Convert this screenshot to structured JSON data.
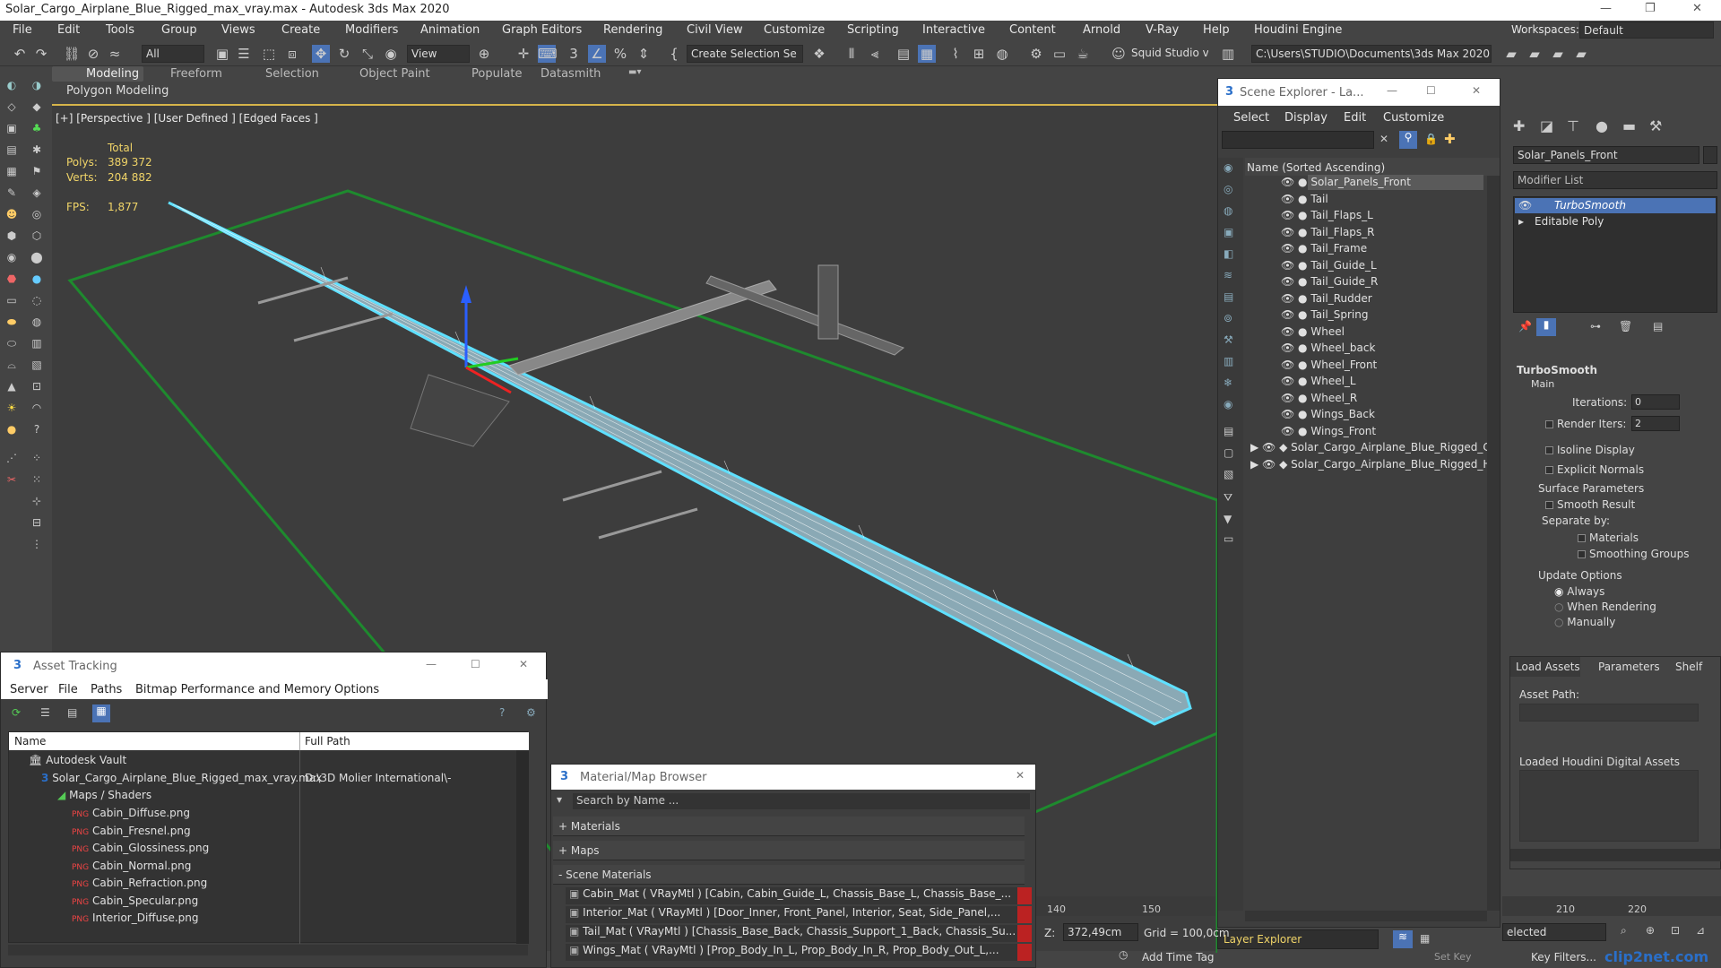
{
  "window": {
    "title": "Solar_Cargo_Airplane_Blue_Rigged_max_vray.max - Autodesk 3ds Max 2020"
  },
  "menu": [
    "File",
    "Edit",
    "Tools",
    "Group",
    "Views",
    "Create",
    "Modifiers",
    "Animation",
    "Graph Editors",
    "Rendering",
    "Civil View",
    "Customize",
    "Scripting",
    "Interactive",
    "Content",
    "Arnold",
    "V-Ray",
    "Help",
    "Houdini Engine"
  ],
  "workspaces": {
    "label": "Workspaces:",
    "value": "Default"
  },
  "toolbar": {
    "filter": "All",
    "ref_coord": "View",
    "selection_set": "Create Selection Se",
    "account": "Squid Studio v",
    "path": "C:\\Users\\STUDIO\\Documents\\3ds Max 2020"
  },
  "ribbon": {
    "tabs": [
      "Modeling",
      "Freeform",
      "Selection",
      "Object Paint",
      "Populate",
      "Datasmith"
    ],
    "sub": "Polygon Modeling"
  },
  "viewport": {
    "label": "[+] [Perspective ] [User Defined ] [Edged Faces ]",
    "total": "Total",
    "polys_label": "Polys:",
    "polys": "389 372",
    "verts_label": "Verts:",
    "verts": "204 882",
    "fps_label": "FPS:",
    "fps": "1,877"
  },
  "scene_explorer": {
    "title": "Scene Explorer - La...",
    "menus": [
      "Select",
      "Display",
      "Edit",
      "Customize"
    ],
    "column": "Name (Sorted Ascending)",
    "items": [
      "Solar_Panels_Front",
      "Tail",
      "Tail_Flaps_L",
      "Tail_Flaps_R",
      "Tail_Frame",
      "Tail_Guide_L",
      "Tail_Guide_R",
      "Tail_Rudder",
      "Tail_Spring",
      "Wheel",
      "Wheel_back",
      "Wheel_Front",
      "Wheel_L",
      "Wheel_R",
      "Wings_Back",
      "Wings_Front"
    ],
    "groups": [
      "Solar_Cargo_Airplane_Blue_Rigged_C",
      "Solar_Cargo_Airplane_Blue_Rigged_H"
    ],
    "footer": "Layer Explorer"
  },
  "command_panel": {
    "object_name": "Solar_Panels_Front",
    "modifier_list": "Modifier List",
    "stack": [
      "TurboSmooth",
      "Editable Poly"
    ],
    "rollout": "TurboSmooth",
    "main": "Main",
    "iterations_label": "Iterations:",
    "iterations": "0",
    "render_iters_label": "Render Iters:",
    "render_iters": "2",
    "isoline": "Isoline Display",
    "explicit": "Explicit Normals",
    "surface": "Surface Parameters",
    "smooth": "Smooth Result",
    "separate": "Separate by:",
    "materials": "Materials",
    "smoothing": "Smoothing Groups",
    "update": "Update Options",
    "always": "Always",
    "when_rendering": "When Rendering",
    "manually": "Manually"
  },
  "houdini": {
    "tabs": [
      "Load Assets",
      "Parameters",
      "Shelf"
    ],
    "asset_path": "Asset Path:",
    "loaded": "Loaded Houdini Digital Assets"
  },
  "asset_tracking": {
    "title": "Asset Tracking",
    "menus": [
      "Server",
      "File",
      "Paths",
      "Bitmap Performance and Memory",
      "Options"
    ],
    "col_name": "Name",
    "col_path": "Full Path",
    "vault": "Autodesk Vault",
    "file": "Solar_Cargo_Airplane_Blue_Rigged_max_vray.max",
    "file_path": "D:\\3D Molier International\\-",
    "maps": "Maps / Shaders",
    "bitmaps": [
      "Cabin_Diffuse.png",
      "Cabin_Fresnel.png",
      "Cabin_Glossiness.png",
      "Cabin_Normal.png",
      "Cabin_Refraction.png",
      "Cabin_Specular.png",
      "Interior_Diffuse.png"
    ]
  },
  "material_browser": {
    "title": "Material/Map Browser",
    "search": "Search by Name ...",
    "groups": [
      "+ Materials",
      "+ Maps",
      "- Scene Materials"
    ],
    "materials": [
      "Cabin_Mat  ( VRayMtl ) [Cabin, Cabin_Guide_L, Chassis_Base_L, Chassis_Base_...",
      "Interior_Mat  ( VRayMtl )  [Door_Inner, Front_Panel, Interior, Seat, Side_Panel,...",
      "Tail_Mat  ( VRayMtl ) [Chassis_Base_Back, Chassis_Support_1_Back, Chassis_Su...",
      "Wings_Mat  ( VRayMtl ) [Prop_Body_In_L, Prop_Body_In_R, Prop_Body_Out_L,..."
    ]
  },
  "timeline": {
    "ticks": [
      "140",
      "150",
      "210",
      "220"
    ]
  },
  "status": {
    "z_label": "Z:",
    "z": "372,49cm",
    "grid": "Grid = 100,0cm",
    "add_time_tag": "Add Time Tag",
    "selected": "elected",
    "set_key": "Set Key",
    "key_filters": "Key Filters...",
    "watermark": "clip2net.com"
  },
  "colors": {
    "wire": "#5fe0ff",
    "grid": "#1e8a2e",
    "accent": "#d6b44a",
    "selection": "#4b73b5"
  }
}
